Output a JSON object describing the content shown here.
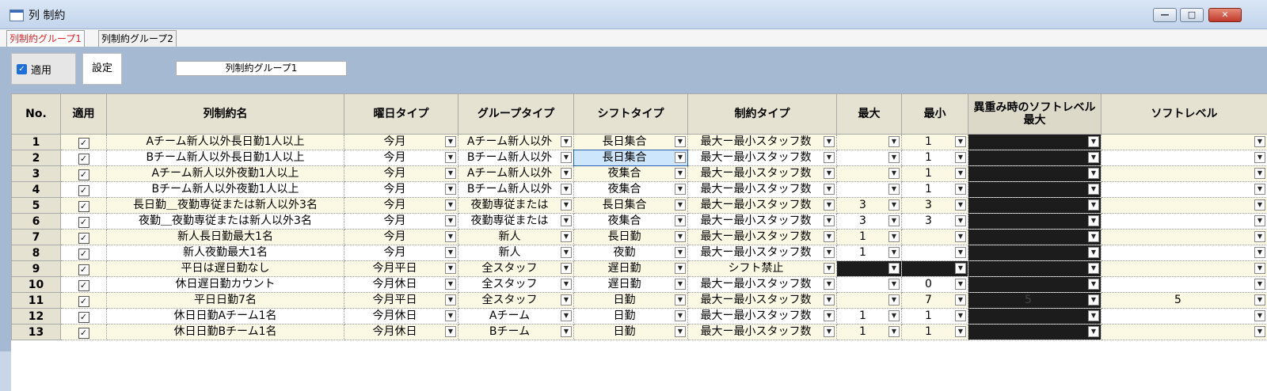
{
  "window": {
    "title": "列 制約",
    "min": "—",
    "max": "□",
    "close": "✕"
  },
  "tabs": [
    {
      "label": "列制約グループ1",
      "active": true
    },
    {
      "label": "列制約グループ2",
      "active": false
    }
  ],
  "toolbar": {
    "apply_label": "適用",
    "apply_checked": true,
    "settings_label": "設定",
    "group_name": "列制約グループ1"
  },
  "grid": {
    "headers": {
      "no": "No.",
      "apply": "適用",
      "name": "列制約名",
      "day": "曜日タイプ",
      "group": "グループタイプ",
      "shift": "シフトタイプ",
      "constraint": "制約タイプ",
      "max": "最大",
      "min": "最小",
      "weight_l1": "異重み時のソフトレベル",
      "weight_l2": "最大",
      "soft": "ソフトレベル"
    },
    "rows": [
      {
        "no": "1",
        "name": "Aチーム新人以外長日勤1人以上",
        "day": "今月",
        "group": "Aチーム新人以外",
        "shift": "長日集合",
        "constraint": "最大ー最小スタッフ数",
        "max": "",
        "min": "1",
        "weight": "",
        "soft": ""
      },
      {
        "no": "2",
        "name": "Bチーム新人以外長日勤1人以上",
        "day": "今月",
        "group": "Bチーム新人以外",
        "shift": "長日集合",
        "constraint": "最大ー最小スタッフ数",
        "max": "",
        "min": "1",
        "weight": "",
        "soft": ""
      },
      {
        "no": "3",
        "name": "Aチーム新人以外夜勤1人以上",
        "day": "今月",
        "group": "Aチーム新人以外",
        "shift": "夜集合",
        "constraint": "最大ー最小スタッフ数",
        "max": "",
        "min": "1",
        "weight": "",
        "soft": ""
      },
      {
        "no": "4",
        "name": "Bチーム新人以外夜勤1人以上",
        "day": "今月",
        "group": "Bチーム新人以外",
        "shift": "夜集合",
        "constraint": "最大ー最小スタッフ数",
        "max": "",
        "min": "1",
        "weight": "",
        "soft": ""
      },
      {
        "no": "5",
        "name": "長日勤＿夜勤専従または新人以外3名",
        "day": "今月",
        "group": "夜勤専従または",
        "shift": "長日集合",
        "constraint": "最大ー最小スタッフ数",
        "max": "3",
        "min": "3",
        "weight": "",
        "soft": ""
      },
      {
        "no": "6",
        "name": "夜勤＿夜勤専従または新人以外3名",
        "day": "今月",
        "group": "夜勤専従または",
        "shift": "夜集合",
        "constraint": "最大ー最小スタッフ数",
        "max": "3",
        "min": "3",
        "weight": "",
        "soft": ""
      },
      {
        "no": "7",
        "name": "新人長日勤最大1名",
        "day": "今月",
        "group": "新人",
        "shift": "長日勤",
        "constraint": "最大ー最小スタッフ数",
        "max": "1",
        "min": "",
        "weight": "",
        "soft": ""
      },
      {
        "no": "8",
        "name": "新人夜勤最大1名",
        "day": "今月",
        "group": "新人",
        "shift": "夜勤",
        "constraint": "最大ー最小スタッフ数",
        "max": "1",
        "min": "",
        "weight": "",
        "soft": ""
      },
      {
        "no": "9",
        "name": "平日は遅日勤なし",
        "day": "今月平日",
        "group": "全スタッフ",
        "shift": "遅日勤",
        "constraint": "シフト禁止",
        "max": "",
        "min": "",
        "weight": "",
        "soft": ""
      },
      {
        "no": "10",
        "name": "休日遅日勤カウント",
        "day": "今月休日",
        "group": "全スタッフ",
        "shift": "遅日勤",
        "constraint": "最大ー最小スタッフ数",
        "max": "",
        "min": "0",
        "weight": "",
        "soft": ""
      },
      {
        "no": "11",
        "name": "平日日勤7名",
        "day": "今月平日",
        "group": "全スタッフ",
        "shift": "日勤",
        "constraint": "最大ー最小スタッフ数",
        "max": "",
        "min": "7",
        "weight": "5",
        "soft": "5"
      },
      {
        "no": "12",
        "name": "休日日勤Aチーム1名",
        "day": "今月休日",
        "group": "Aチーム",
        "shift": "日勤",
        "constraint": "最大ー最小スタッフ数",
        "max": "1",
        "min": "1",
        "weight": "",
        "soft": ""
      },
      {
        "no": "13",
        "name": "休日日勤Bチーム1名",
        "day": "今月休日",
        "group": "Bチーム",
        "shift": "日勤",
        "constraint": "最大ー最小スタッフ数",
        "max": "1",
        "min": "1",
        "weight": "",
        "soft": ""
      }
    ]
  }
}
